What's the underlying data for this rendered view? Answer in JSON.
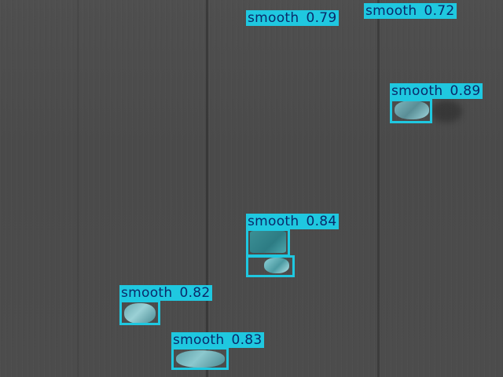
{
  "detections": [
    {
      "label": "smooth",
      "score": "0.79"
    },
    {
      "label": "smooth",
      "score": "0.72"
    },
    {
      "label": "smooth",
      "score": "0.89"
    },
    {
      "label": "smooth",
      "score": "0.84"
    },
    {
      "label": "smooth",
      "score": "0.82"
    },
    {
      "label": "smooth",
      "score": "0.83"
    }
  ],
  "colors": {
    "box": "#1fc8e0",
    "label_text": "#0a2a6a",
    "background": "#4a4a4a"
  }
}
